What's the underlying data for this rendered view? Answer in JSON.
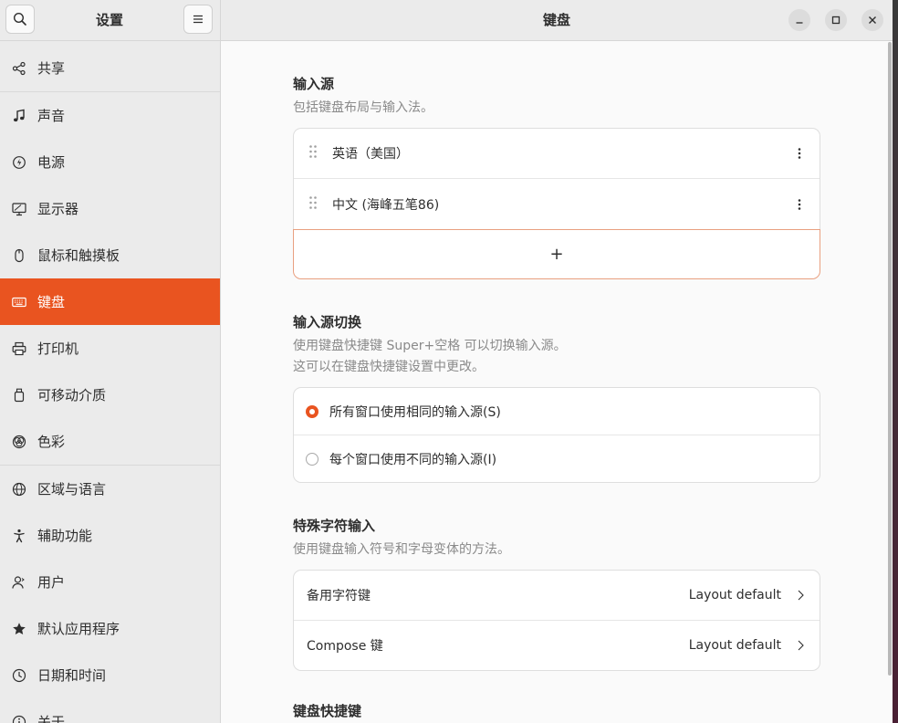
{
  "sidebar": {
    "title": "设置",
    "items": [
      {
        "label": "共享",
        "icon": "share-icon"
      },
      {
        "label": "声音",
        "icon": "music-note-icon"
      },
      {
        "label": "电源",
        "icon": "power-icon"
      },
      {
        "label": "显示器",
        "icon": "display-icon"
      },
      {
        "label": "鼠标和触摸板",
        "icon": "mouse-icon"
      },
      {
        "label": "键盘",
        "icon": "keyboard-icon",
        "active": true
      },
      {
        "label": "打印机",
        "icon": "printer-icon"
      },
      {
        "label": "可移动介质",
        "icon": "removable-media-icon"
      },
      {
        "label": "色彩",
        "icon": "color-icon"
      },
      {
        "label": "区域与语言",
        "icon": "globe-icon"
      },
      {
        "label": "辅助功能",
        "icon": "accessibility-icon"
      },
      {
        "label": "用户",
        "icon": "user-icon"
      },
      {
        "label": "默认应用程序",
        "icon": "star-icon"
      },
      {
        "label": "日期和时间",
        "icon": "clock-icon"
      },
      {
        "label": "关于",
        "icon": "info-icon"
      }
    ]
  },
  "header": {
    "title": "键盘"
  },
  "input_sources": {
    "title": "输入源",
    "description": "包括键盘布局与输入法。",
    "sources": [
      "英语（美国）",
      "中文 (海峰五笔86)"
    ],
    "add_label": "+"
  },
  "switching": {
    "title": "输入源切换",
    "description_line1": "使用键盘快捷键 Super+空格 可以切换输入源。",
    "description_line2": "这可以在键盘快捷键设置中更改。",
    "options": [
      {
        "label": "所有窗口使用相同的输入源(S)",
        "selected": true
      },
      {
        "label": "每个窗口使用不同的输入源(I)",
        "selected": false
      }
    ]
  },
  "special_chars": {
    "title": "特殊字符输入",
    "description": "使用键盘输入符号和字母变体的方法。",
    "rows": [
      {
        "label": "备用字符键",
        "value": "Layout default"
      },
      {
        "label": "Compose 键",
        "value": "Layout default"
      }
    ]
  },
  "shortcuts": {
    "title": "键盘快捷键"
  },
  "colors": {
    "accent": "#e95420",
    "sidebar_bg": "#ebebeb",
    "content_bg": "#fafafa"
  }
}
